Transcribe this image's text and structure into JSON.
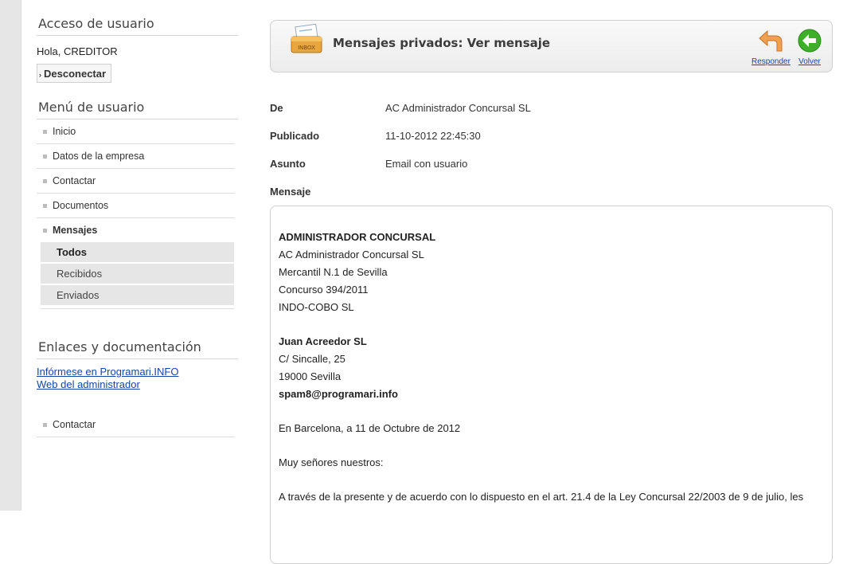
{
  "sidebar": {
    "access_title": "Acceso de usuario",
    "greeting": "Hola, CREDITOR",
    "disconnect_label": "Desconectar",
    "menu_title": "Menú de usuario",
    "menu_items": [
      "Inicio",
      "Datos de la empresa",
      "Contactar",
      "Documentos",
      "Mensajes"
    ],
    "submenu_items": [
      "Todos",
      "Recibidos",
      "Enviados"
    ],
    "links_title": "Enlaces y documentación",
    "links": [
      "Infórmese en Programari.INFO",
      "Web del administrador"
    ],
    "bottom_item": "Contactar"
  },
  "header": {
    "icon_text": "INBOX",
    "title": "Mensajes privados: Ver mensaje",
    "reply_label": "Responder",
    "back_label": "Volver"
  },
  "fields": {
    "from_label": "De",
    "from_value": "AC Administrador Concursal SL",
    "published_label": "Publicado",
    "published_value": "11-10-2012 22:45:30",
    "subject_label": "Asunto",
    "subject_value": "Email con usuario",
    "message_label": "Mensaje"
  },
  "message": {
    "sender_heading": "ADMINISTRADOR CONCURSAL",
    "sender_lines": [
      "AC Administrador Concursal SL",
      "Mercantil N.1 de Sevilla",
      "Concurso 394/2011",
      "INDO-COBO SL"
    ],
    "recipient_heading": "Juan Acreedor SL",
    "recipient_lines": [
      "C/ Sincalle, 25",
      "19000 Sevilla"
    ],
    "recipient_email": "spam8@programari.info",
    "date_line": "En Barcelona, a 11 de Octubre de 2012",
    "salutation": "Muy señores nuestros:",
    "body_start": "A través de la presente y de acuerdo con lo dispuesto en el art. 21.4 de la Ley Concursal 22/2003 de 9 de julio, les"
  },
  "colors": {
    "link": "#1a44a1",
    "rail": "#e6e6e6",
    "submenu_bg": "#e6e6e6",
    "reply_arrow": "#f0a050",
    "back_circle": "#3fae2a"
  }
}
